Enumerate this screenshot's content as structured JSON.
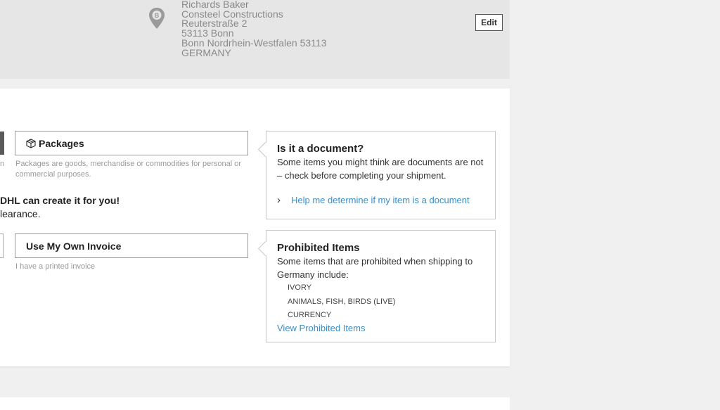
{
  "address": {
    "lines": [
      "Richards Baker",
      "Consteel Constructions",
      "Reuterstraße 2",
      "53113 Bonn",
      "Bonn Nordrhein-Westfalen 53113",
      "GERMANY"
    ],
    "pin_letter": "B",
    "edit_label": "Edit"
  },
  "shipment_type": {
    "partial_text": "n",
    "packages_label": "Packages",
    "packages_desc": "Packages are goods, merchandise or commodities for personal or commercial purposes."
  },
  "invoice": {
    "note_line1": "DHL can create it for you!",
    "note_line2": "learance.",
    "own_invoice_label": "Use My Own Invoice",
    "own_invoice_desc": "I have a printed invoice"
  },
  "document_info": {
    "title": "Is it a document?",
    "text": "Some items you might think are documents are not – check before completing your shipment.",
    "link_chevron": "›",
    "link": "Help me determine if my item is a document"
  },
  "prohibited": {
    "title": "Prohibited Items",
    "text": "Some items that are prohibited when shipping to Germany include:",
    "items": [
      "IVORY",
      "ANIMALS, FISH, BIRDS (LIVE)",
      "CURRENCY"
    ],
    "link": "View Prohibited Items"
  },
  "icons": {
    "pin": "map-pin-icon",
    "package": "package-box-icon",
    "chevron": "chevron-right-icon"
  },
  "colors": {
    "link": "#3a8dc5",
    "panel": "#e6e6e6",
    "page": "#f0f0f0"
  }
}
